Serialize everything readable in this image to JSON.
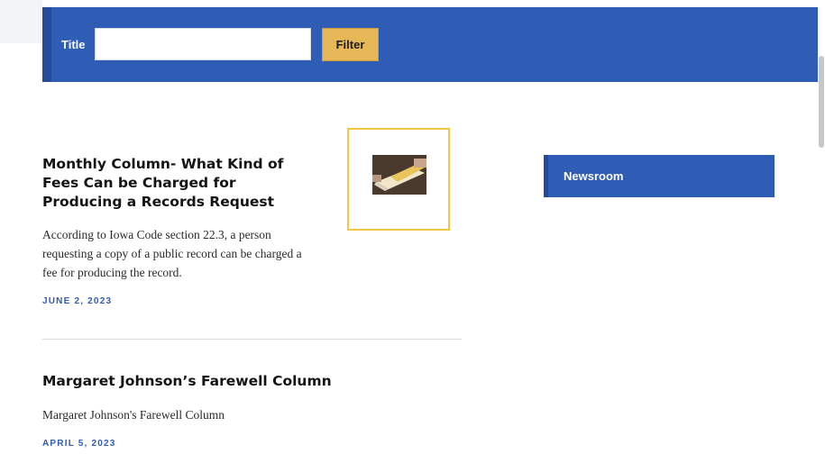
{
  "filter": {
    "label": "Title",
    "input_value": "",
    "button_label": "Filter"
  },
  "articles": [
    {
      "title": "Monthly Column- What Kind of Fees Can be Charged for Producing a Records Request",
      "excerpt": "According to Iowa Code section 22.3, a person requesting a copy of a public record can be charged a fee for producing the record.",
      "date": "JUNE 2, 2023"
    },
    {
      "title": "Margaret Johnson’s Farewell Column",
      "excerpt": "Margaret Johnson's Farewell Column",
      "date": "APRIL 5, 2023"
    }
  ],
  "sidebar": {
    "newsroom_label": "Newsroom"
  },
  "colors": {
    "primary_blue": "#2f5cb4",
    "dark_blue_accent": "#244a99",
    "filter_button_gold": "#e6b857",
    "thumbnail_border_yellow": "#f2c744"
  }
}
